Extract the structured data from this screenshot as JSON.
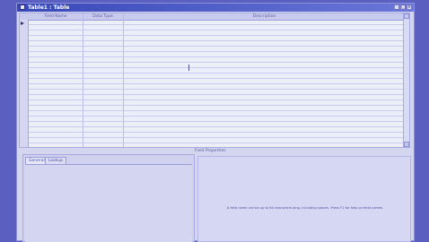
{
  "window": {
    "title": "Table1 : Table",
    "buttons": {
      "minimize": "_",
      "maximize": "□",
      "close": "×"
    }
  },
  "grid": {
    "headers": [
      "Field Name",
      "Data Type",
      "Description"
    ],
    "visible_rows": 24
  },
  "field_properties": {
    "label": "Field Properties",
    "tabs": [
      "General",
      "Lookup"
    ],
    "active_tab": "General",
    "hint": "A field name can be up to 64 characters long, including spaces. Press F1 for help on field names."
  }
}
